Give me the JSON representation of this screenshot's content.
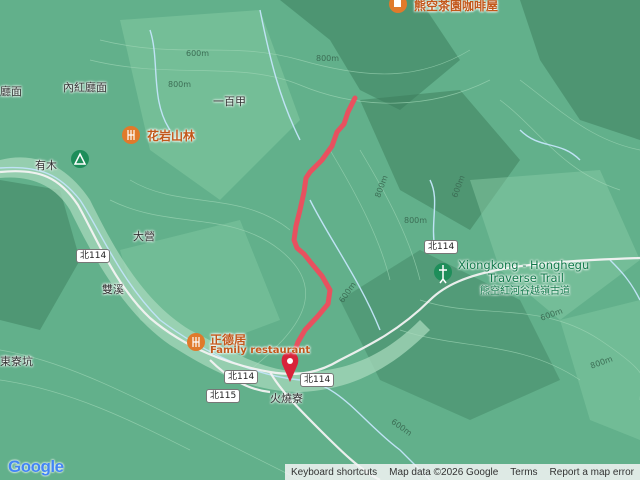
{
  "map": {
    "places": {
      "cafe_label": "熊空茶園咖啡屋",
      "neihong": "內紅廳面",
      "liang_mian": "廳面",
      "yibaijia": "一百甲",
      "huayan_label": "花岩山林",
      "youmu": "有木",
      "dayi": "大營",
      "shuangxi": "雙溪",
      "dongliaokeng": "東寮坑",
      "zhengde_label": "正德居",
      "zhengde_sub": "Family restaurant",
      "huoshaoliao": "火燒寮",
      "trail_en_1": "Xiongkong - Honghegu",
      "trail_en_2": "Traverse Trail",
      "trail_zh": "熊空紅河谷越嶺古道"
    },
    "roads": {
      "r1": "北114",
      "r2": "北114",
      "r3": "北114",
      "r4": "北114",
      "r5": "北115"
    },
    "contours": {
      "c1": "600m",
      "c2": "800m",
      "c3": "800m",
      "c4": "600m",
      "c5": "800m",
      "c6": "600m",
      "c7": "600m",
      "c8": "800m",
      "c9": "600m",
      "c10": "800m"
    },
    "colors": {
      "route": "#e8515f",
      "terrain": "#5fae8a",
      "water": "#b3d9f2",
      "poi": "#e07a2b",
      "park": "#1e8e5a"
    }
  },
  "footer": {
    "logo": "Google",
    "shortcuts": "Keyboard shortcuts",
    "mapdata": "Map data ©2026 Google",
    "terms": "Terms",
    "report": "Report a map error"
  }
}
